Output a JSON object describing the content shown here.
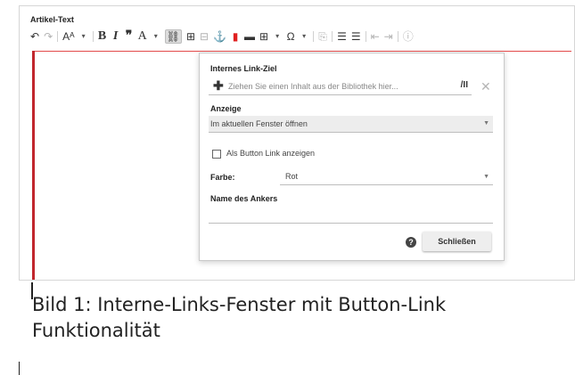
{
  "field": {
    "label": "Artikel-Text"
  },
  "toolbar": {
    "undo_icon": "↶",
    "redo_icon": "↷",
    "format_icon": "Aᴬ",
    "format_dropdown": "▾",
    "bold": "B",
    "italic": "I",
    "quote": "❞",
    "text_color": "A",
    "text_color_dropdown": "▾",
    "link_icon": "⛓",
    "link_add_icon": "⊞",
    "unlink_icon": "⊟",
    "anchor_icon": "⚓",
    "media_icon": "▮",
    "box_icon": "▬",
    "table_icon": "⊞",
    "table_dropdown": "▾",
    "special_char": "Ω",
    "special_char_dropdown": "▾",
    "paste_icon": "⎘",
    "numbered_list_icon": "☰",
    "bullet_list_icon": "☰",
    "outdent_icon": "⇤",
    "indent_icon": "⇥",
    "info_icon": "ⓘ"
  },
  "dialog": {
    "link_target_label": "Internes Link-Ziel",
    "link_target_placeholder": "Ziehen Sie einen Inhalt aus der Bibliothek hier...",
    "link_symbol": "/II",
    "display_label": "Anzeige",
    "display_value": "Im aktuellen Fenster öffnen",
    "button_link_label": "Als Button Link anzeigen",
    "color_label": "Farbe:",
    "color_value": "Rot",
    "anchor_label": "Name des Ankers",
    "anchor_value": "",
    "help_icon": "?",
    "close_label": "Schließen",
    "dropdown_arrow": "▼",
    "add_icon": "✚",
    "clear_icon": "✕"
  },
  "caption": {
    "line1": "Bild 1: Interne-Links-Fenster mit Button-Link",
    "line2": "Funktionalität"
  }
}
